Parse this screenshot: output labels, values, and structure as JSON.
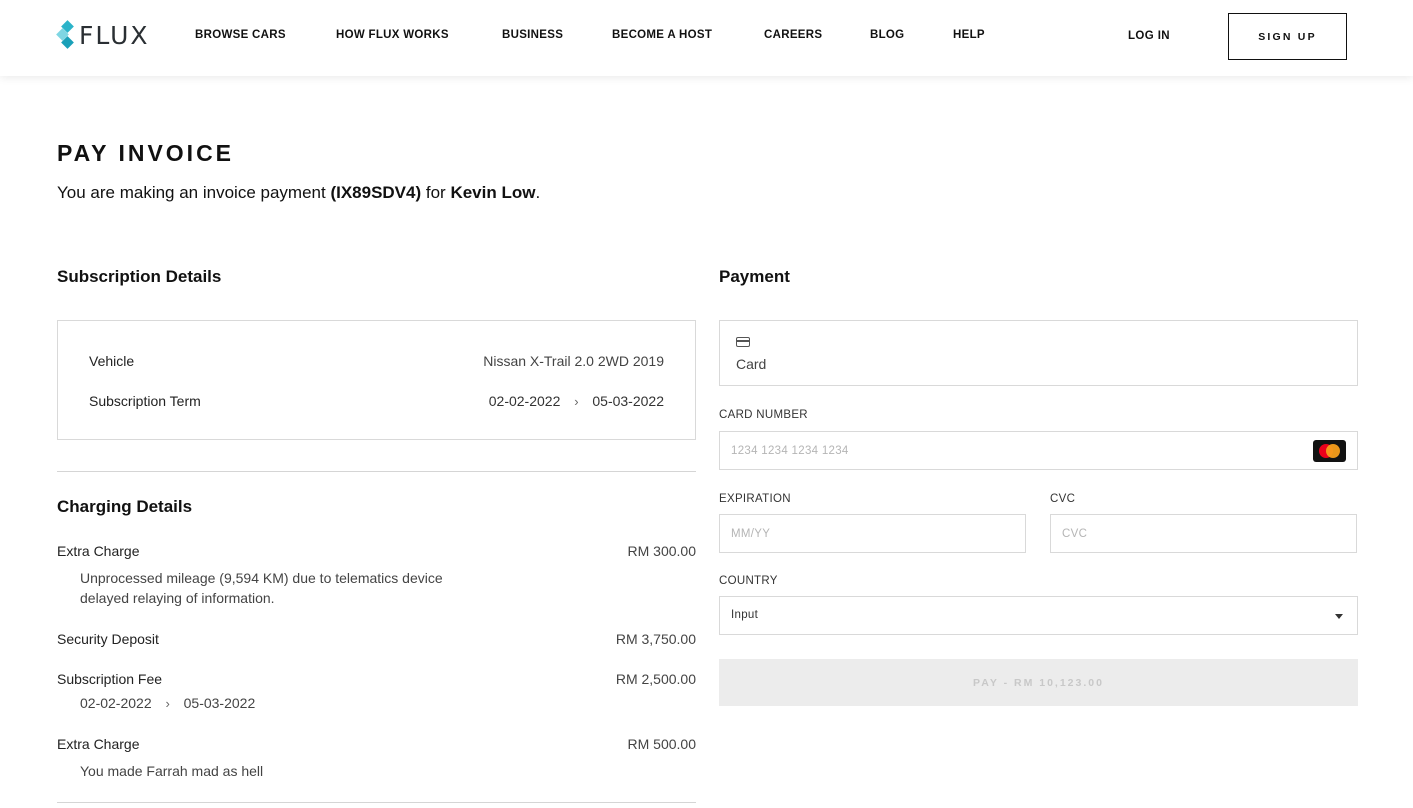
{
  "brand": {
    "name": "FLUX"
  },
  "nav": {
    "items": [
      "BROWSE CARS",
      "HOW FLUX WORKS",
      "BUSINESS",
      "BECOME A HOST",
      "CAREERS",
      "BLOG",
      "HELP"
    ],
    "login": "LOG IN",
    "signup": "SIGN UP"
  },
  "page": {
    "title": "PAY INVOICE",
    "intro_prefix": "You are making an invoice payment ",
    "invoice_id": "(IX89SDV4)",
    "intro_for": " for ",
    "customer": "Kevin Low",
    "intro_suffix": "."
  },
  "subscription": {
    "heading": "Subscription Details",
    "vehicle_label": "Vehicle",
    "vehicle_value": "Nissan X-Trail 2.0 2WD 2019",
    "term_label": "Subscription Term",
    "term_start": "02-02-2022",
    "term_end": "05-03-2022"
  },
  "charging": {
    "heading": "Charging Details",
    "items": [
      {
        "label": "Extra Charge",
        "amount": "RM 300.00",
        "description": "Unprocessed mileage (9,594 KM) due to telematics device delayed relaying of information."
      },
      {
        "label": "Security Deposit",
        "amount": "RM 3,750.00"
      },
      {
        "label": "Subscription Fee",
        "amount": "RM 2,500.00",
        "term_start": "02-02-2022",
        "term_end": "05-03-2022"
      },
      {
        "label": "Extra Charge",
        "amount": "RM 500.00",
        "description": "You made Farrah mad as hell"
      }
    ]
  },
  "payment": {
    "heading": "Payment",
    "method_label": "Card",
    "card_number_label": "CARD NUMBER",
    "card_number_placeholder": "1234 1234 1234 1234",
    "expiration_label": "EXPIRATION",
    "expiration_placeholder": "MM/YY",
    "cvc_label": "CVC",
    "cvc_placeholder": "CVC",
    "country_label": "COUNTRY",
    "country_value": "Input",
    "pay_button": "PAY - RM 10,123.00"
  },
  "icons": {
    "card_method": "credit-card-icon",
    "card_brand": "mastercard-icon",
    "select_caret": "caret-down-icon",
    "term_arrow": "chevron-right-icon"
  }
}
